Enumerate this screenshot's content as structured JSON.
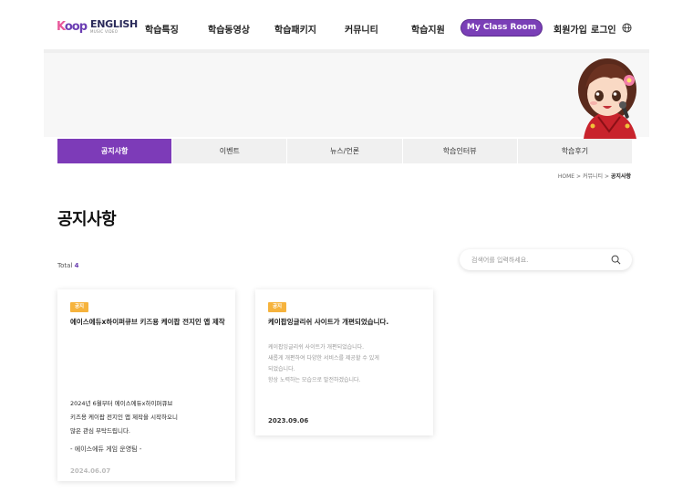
{
  "header": {
    "logo_mark": "K",
    "logo_mark_rest": "oop",
    "logo_text": "ENGLISH",
    "logo_sub": "MUSIC VIDEO",
    "nav": [
      "학습특징",
      "학습동영상",
      "학습패키지",
      "커뮤니티",
      "학습지원"
    ],
    "my_class_room": "My Class Room",
    "signup": "회원가입",
    "login": "로그인",
    "globe_icon": "globe-icon"
  },
  "tabs": [
    "공지사항",
    "이벤트",
    "뉴스/언론",
    "학습인터뷰",
    "학습후기"
  ],
  "breadcrumb": {
    "home": "HOME",
    "sep1": ">",
    "section": "커뮤니티",
    "sep2": ">",
    "current": "공지사항"
  },
  "page_title": "공지사항",
  "total": {
    "label": "Total",
    "count": "4"
  },
  "search": {
    "placeholder": "검색어를 입력하세요."
  },
  "colors": {
    "accent": "#7d3bb8",
    "badge": "#f6b33d"
  },
  "cards": [
    {
      "badge": "공지",
      "title": "에이스에듀x하이퍼큐브 키즈용 케이팝 전지인 앱 제작",
      "body": [
        "2024년 6월부터 에이스에듀x하이퍼큐브",
        "키즈용 케이팝 전지인 앱 제작을 시작하오니",
        "많은 관심 부탁드립니다."
      ],
      "sign": "- 에이스에듀 게임 운영팀 -",
      "date": "2024.06.07"
    },
    {
      "badge": "공지",
      "title": "케이팝잉글리쉬 사이트가 개편되었습니다.",
      "body": [
        "케이팝잉글리쉬 사이트가 개편되었습니다.",
        "새롭게 개편하여 다양한 서비스를 제공할 수 있게",
        "되었습니다.",
        "항상 노력하는 모습으로 발전하겠습니다."
      ],
      "date": "2023.09.06"
    }
  ]
}
